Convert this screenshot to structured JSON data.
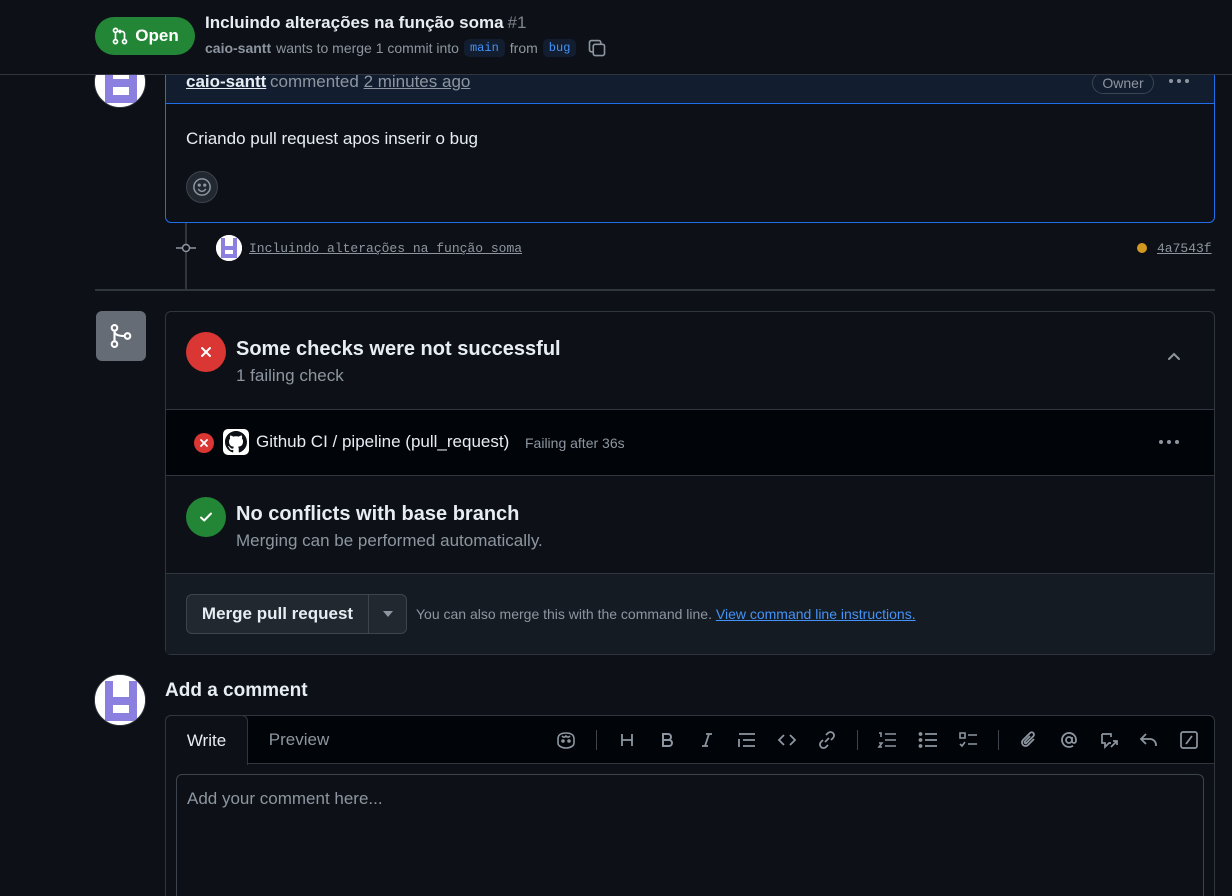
{
  "header": {
    "state_label": "Open",
    "title": "Incluindo alterações na função soma",
    "number": "#1",
    "author": "caio-santt",
    "merge_text": "wants to merge 1 commit into",
    "base_branch": "main",
    "from_text": "from",
    "head_branch": "bug"
  },
  "comment": {
    "author": "caio-santt",
    "action": "commented",
    "time": "2 minutes ago",
    "role_badge": "Owner",
    "body": "Criando pull request apos inserir o bug"
  },
  "commit": {
    "message": "Incluindo alterações na função soma",
    "sha": "4a7543f",
    "status_color": "#d29922"
  },
  "checks": {
    "title": "Some checks were not successful",
    "subtitle": "1 failing check",
    "items": [
      {
        "name": "Github CI / pipeline (pull_request)",
        "status": "Failing after 36s"
      }
    ]
  },
  "conflicts": {
    "title": "No conflicts with base branch",
    "subtitle": "Merging can be performed automatically."
  },
  "merge": {
    "button_label": "Merge pull request",
    "hint": "You can also merge this with the command line.",
    "hint_link": "View command line instructions."
  },
  "add_comment": {
    "title": "Add a comment",
    "tab_write": "Write",
    "tab_preview": "Preview",
    "placeholder": "Add your comment here...",
    "toolbar_icons": [
      "copilot-icon",
      "heading-icon",
      "bold-icon",
      "italic-icon",
      "quote-icon",
      "code-icon",
      "link-icon",
      "ordered-list-icon",
      "unordered-list-icon",
      "task-list-icon",
      "attach-icon",
      "mention-icon",
      "reference-icon",
      "reply-icon",
      "slash-command-icon"
    ]
  },
  "colors": {
    "background": "#0d1117",
    "open_green": "#238636",
    "fail_red": "#da3633",
    "success_green": "#238636",
    "link_blue": "#4493f8",
    "comment_border": "#1f6feb"
  }
}
